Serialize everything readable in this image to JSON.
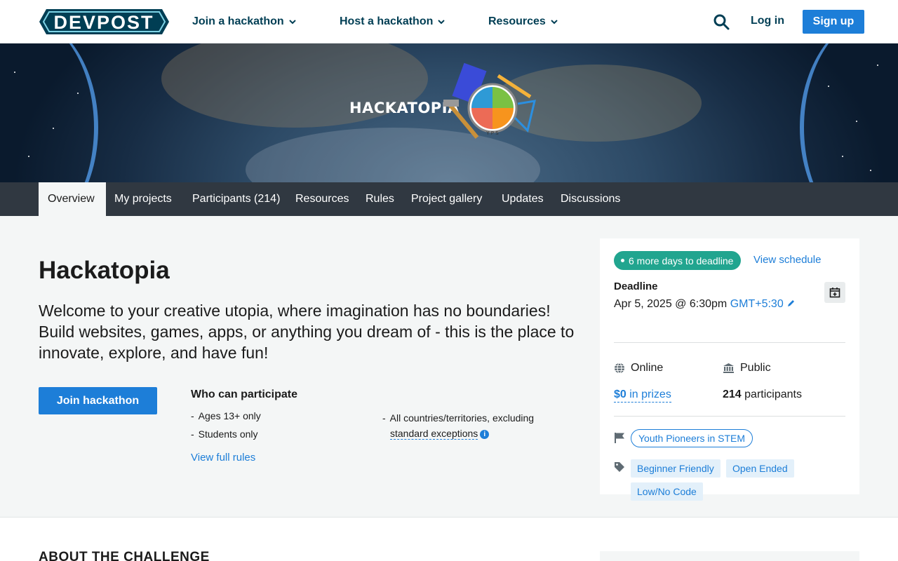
{
  "header": {
    "logo_text": "DEVPOST",
    "nav": [
      {
        "label": "Join a hackathon"
      },
      {
        "label": "Host a hackathon"
      },
      {
        "label": "Resources"
      }
    ],
    "login_label": "Log in",
    "signup_label": "Sign up"
  },
  "banner": {
    "logo_text": "HACKATOPIA",
    "emblem_text": "Youth Pioneers in STEM",
    "emblem_initials": "Y P S"
  },
  "tabs": [
    {
      "label": "Overview"
    },
    {
      "label": "My projects"
    },
    {
      "label": "Participants (214)"
    },
    {
      "label": "Resources"
    },
    {
      "label": "Rules"
    },
    {
      "label": "Project gallery"
    },
    {
      "label": "Updates"
    },
    {
      "label": "Discussions"
    }
  ],
  "main": {
    "title": "Hackatopia",
    "tagline": "Welcome to your creative utopia, where imagination has no boundaries! Build websites, games, apps, or anything you dream of - this is the place to innovate, explore, and have fun!",
    "join_label": "Join hackathon",
    "who_title": "Who can participate",
    "who_items": [
      "Ages 13+ only",
      "Students only"
    ],
    "who_right_1": "All countries/territories, excluding",
    "who_right_2": "standard exceptions",
    "info_glyph": "i",
    "view_rules": "View full rules"
  },
  "sidebar": {
    "deadline_badge": "6 more days to deadline",
    "view_schedule": "View schedule",
    "deadline_label": "Deadline",
    "deadline_date": "Apr 5, 2025 @ 6:30pm",
    "deadline_tz": "GMT+5:30",
    "location": "Online",
    "visibility": "Public",
    "prizes_amount": "$0",
    "prizes_suffix": " in prizes",
    "participants_count": "214",
    "participants_suffix": " participants",
    "organizer": "Youth Pioneers in STEM",
    "themes": [
      "Beginner Friendly",
      "Open Ended",
      "Low/No Code"
    ]
  },
  "lower": {
    "about_title": "ABOUT THE CHALLENGE"
  },
  "colors": {
    "brand_blue": "#1d7ed8",
    "navy": "#003e54",
    "deadline_green": "#21a58f"
  }
}
